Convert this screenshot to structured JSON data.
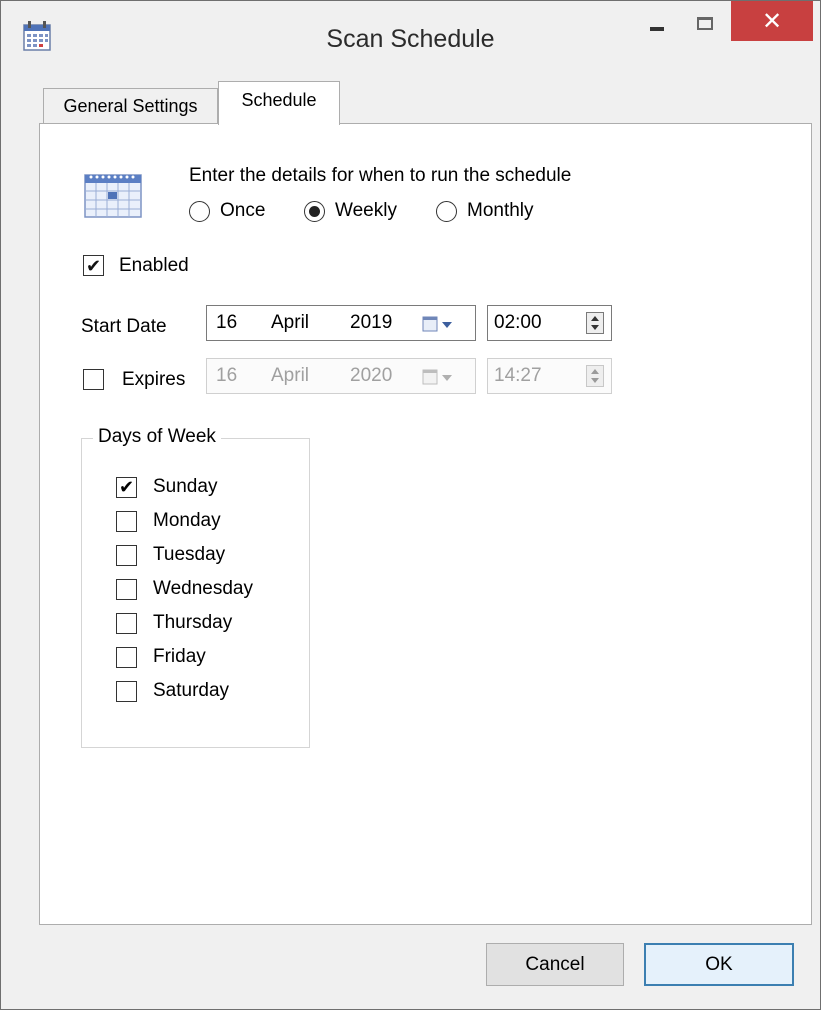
{
  "window": {
    "title": "Scan Schedule",
    "controls": {
      "minimize": "minimize",
      "maximize": "maximize",
      "close": "✕"
    },
    "colors": {
      "close_bg": "#c84040",
      "tab_border": "#adadad",
      "ok_border": "#3c7fb1"
    }
  },
  "tabs": [
    {
      "label": "General Settings",
      "selected": false
    },
    {
      "label": "Schedule",
      "selected": true
    }
  ],
  "schedule": {
    "prompt": "Enter the details for when to run the schedule",
    "frequency": {
      "options": [
        "Once",
        "Weekly",
        "Monthly"
      ],
      "selected": "Weekly"
    },
    "enabled": {
      "label": "Enabled",
      "checked": true,
      "mark": "✔"
    },
    "start": {
      "label": "Start Date",
      "day": "16",
      "month": "April",
      "year": "2019",
      "time": "02:00"
    },
    "expires": {
      "label": "Expires",
      "checked": false,
      "day": "16",
      "month": "April",
      "year": "2020",
      "time": "14:27"
    }
  },
  "days_of_week": {
    "title": "Days of Week",
    "days": [
      {
        "label": "Sunday",
        "checked": true,
        "mark": "✔"
      },
      {
        "label": "Monday",
        "checked": false,
        "mark": ""
      },
      {
        "label": "Tuesday",
        "checked": false,
        "mark": ""
      },
      {
        "label": "Wednesday",
        "checked": false,
        "mark": ""
      },
      {
        "label": "Thursday",
        "checked": false,
        "mark": ""
      },
      {
        "label": "Friday",
        "checked": false,
        "mark": ""
      },
      {
        "label": "Saturday",
        "checked": false,
        "mark": ""
      }
    ]
  },
  "buttons": {
    "cancel": "Cancel",
    "ok": "OK"
  },
  "icons": {
    "app": "calendar-icon",
    "schedule": "calendar-icon",
    "picker": "calendar-dropdown-icon"
  }
}
